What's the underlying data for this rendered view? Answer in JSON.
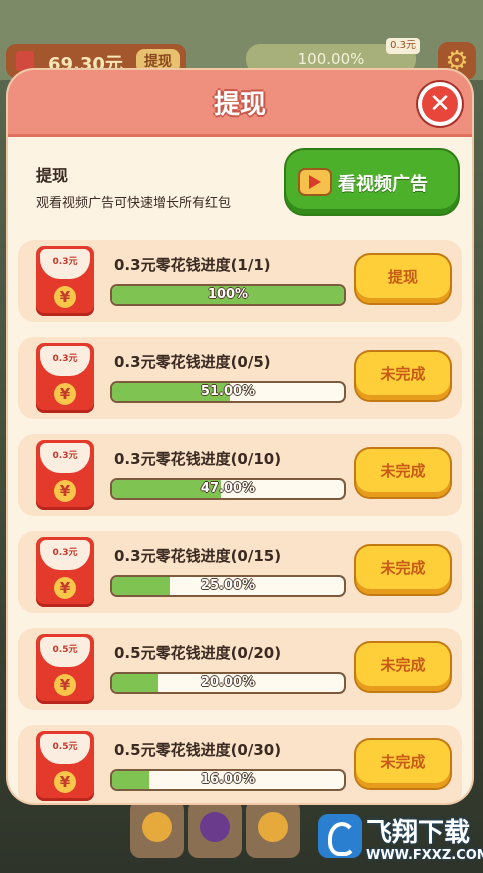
{
  "background": {
    "money": {
      "value": "69.30元",
      "withdraw_label": "提现"
    },
    "progress": {
      "value": "100.00%",
      "tag": "0.3元"
    }
  },
  "modal": {
    "title": "提现",
    "info_title": "提现",
    "info_subtitle": "观看视频广告可快速增长所有红包",
    "ad_button_label": "看视频广告"
  },
  "tasks": [
    {
      "amount": "0.3元",
      "title": "0.3元零花钱进度(1/1)",
      "progress_text": "100%",
      "progress": 1.0,
      "button": "提现"
    },
    {
      "amount": "0.3元",
      "title": "0.3元零花钱进度(0/5)",
      "progress_text": "51.00%",
      "progress": 0.51,
      "button": "未完成"
    },
    {
      "amount": "0.3元",
      "title": "0.3元零花钱进度(0/10)",
      "progress_text": "47.00%",
      "progress": 0.47,
      "button": "未完成"
    },
    {
      "amount": "0.3元",
      "title": "0.3元零花钱进度(0/15)",
      "progress_text": "25.00%",
      "progress": 0.25,
      "button": "未完成"
    },
    {
      "amount": "0.5元",
      "title": "0.5元零花钱进度(0/20)",
      "progress_text": "20.00%",
      "progress": 0.2,
      "button": "未完成"
    },
    {
      "amount": "0.5元",
      "title": "0.5元零花钱进度(0/30)",
      "progress_text": "16.00%",
      "progress": 0.16,
      "button": "未完成"
    }
  ],
  "watermark": {
    "text": "飞翔下载",
    "url": "WWW.FXXZ.COM"
  },
  "colors": {
    "header": "#ef8f7e",
    "fill": "#7fc452",
    "button": "#ffcf3a",
    "ad_button": "#4db02b"
  }
}
